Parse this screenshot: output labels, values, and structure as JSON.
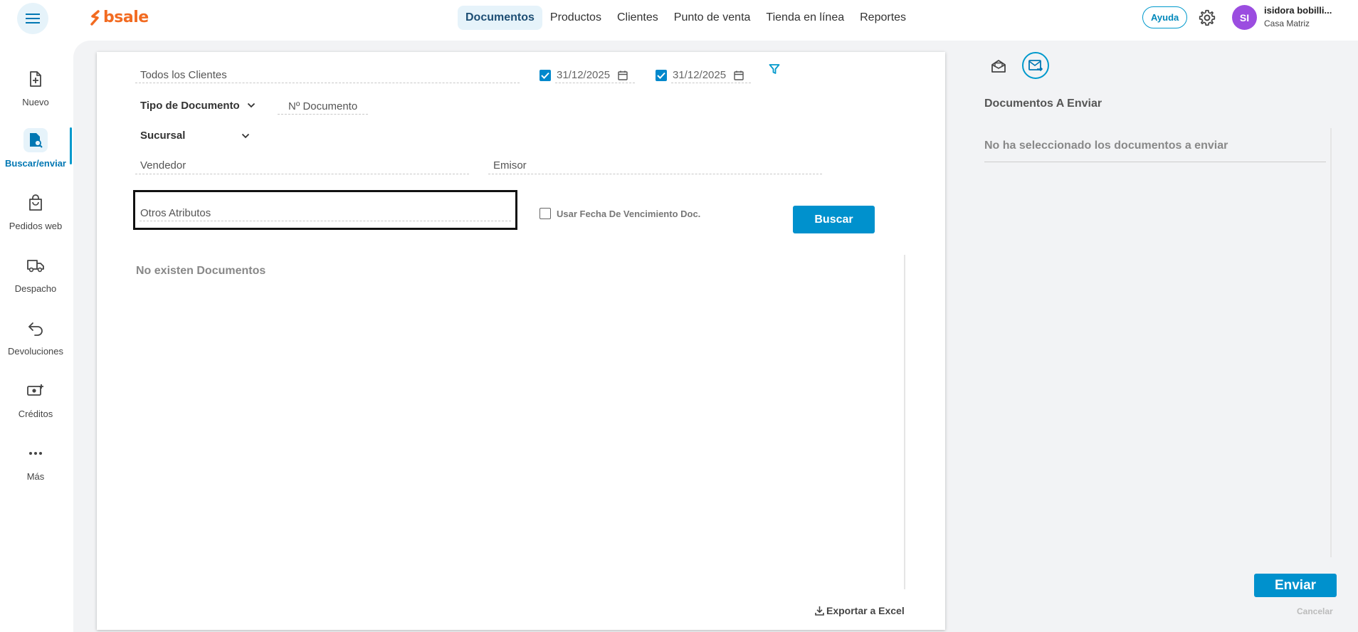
{
  "header": {
    "logo_text": "bsale",
    "nav": [
      {
        "label": "Documentos"
      },
      {
        "label": "Productos"
      },
      {
        "label": "Clientes"
      },
      {
        "label": "Punto de venta"
      },
      {
        "label": "Tienda en línea"
      },
      {
        "label": "Reportes"
      }
    ],
    "help_label": "Ayuda",
    "user_initials": "SI",
    "user_name": "isidora bobilli...",
    "user_branch": "Casa Matriz"
  },
  "sidebar": {
    "items": [
      {
        "label": "Nuevo"
      },
      {
        "label": "Buscar/enviar"
      },
      {
        "label": "Pedidos web"
      },
      {
        "label": "Despacho"
      },
      {
        "label": "Devoluciones"
      },
      {
        "label": "Créditos"
      },
      {
        "label": "Más"
      }
    ]
  },
  "search": {
    "client_placeholder": "Todos los Clientes",
    "date_from": "31/12/2025",
    "date_to": "31/12/2025",
    "doc_type_label": "Tipo de Documento",
    "doc_number_placeholder": "Nº Documento",
    "branch_label": "Sucursal",
    "seller_placeholder": "Vendedor",
    "issuer_placeholder": "Emisor",
    "other_attrs_placeholder": "Otros Atributos",
    "due_date_label": "Usar Fecha De Vencimiento Doc.",
    "search_button": "Buscar",
    "empty_results": "No existen Documentos",
    "export_label": "Exportar a Excel"
  },
  "send_panel": {
    "title": "Documentos A Enviar",
    "empty_text": "No ha seleccionado los documentos a enviar",
    "send_button": "Enviar",
    "cancel_label": "Cancelar"
  },
  "colors": {
    "accent": "#0091cd",
    "brand_orange": "#f26b21",
    "avatar": "#9b4de0"
  }
}
